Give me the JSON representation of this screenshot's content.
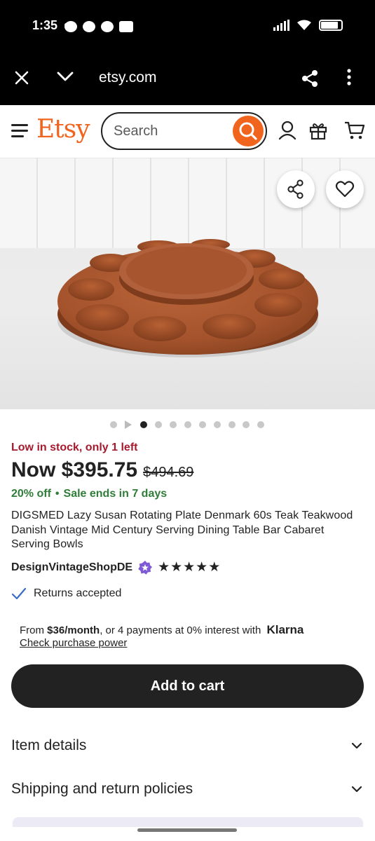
{
  "status_bar": {
    "time": "1:35"
  },
  "browser": {
    "url": "etsy.com"
  },
  "header": {
    "logo": "Etsy",
    "search_placeholder": "Search"
  },
  "gallery": {
    "total_dots": 10,
    "active_index": 1
  },
  "product": {
    "stock_notice": "Low in stock, only 1 left",
    "price_now": "Now $395.75",
    "price_original": "$494.69",
    "discount": "20% off",
    "sale_ends": "Sale ends in 7 days",
    "title": "DIGSMED Lazy Susan Rotating Plate Denmark 60s Teak Teakwood Danish Vintage Mid Century Serving Dining Table Bar Cabaret Serving Bowls",
    "shop_name": "DesignVintageShopDE",
    "rating_stars": 5,
    "returns": "Returns accepted"
  },
  "klarna": {
    "prefix": "From",
    "amount": "$36/month",
    "suffix": ", or 4 payments at 0% interest with",
    "brand": "Klarna",
    "link": "Check purchase power"
  },
  "actions": {
    "add_to_cart": "Add to cart"
  },
  "accordions": [
    {
      "label": "Item details"
    },
    {
      "label": "Shipping and return policies"
    }
  ],
  "colors": {
    "brand": "#f1641e",
    "stock": "#a61a2e",
    "sale": "#2f7d38",
    "primary_button": "#222222",
    "star_seller_badge": "#7f5ad6"
  }
}
